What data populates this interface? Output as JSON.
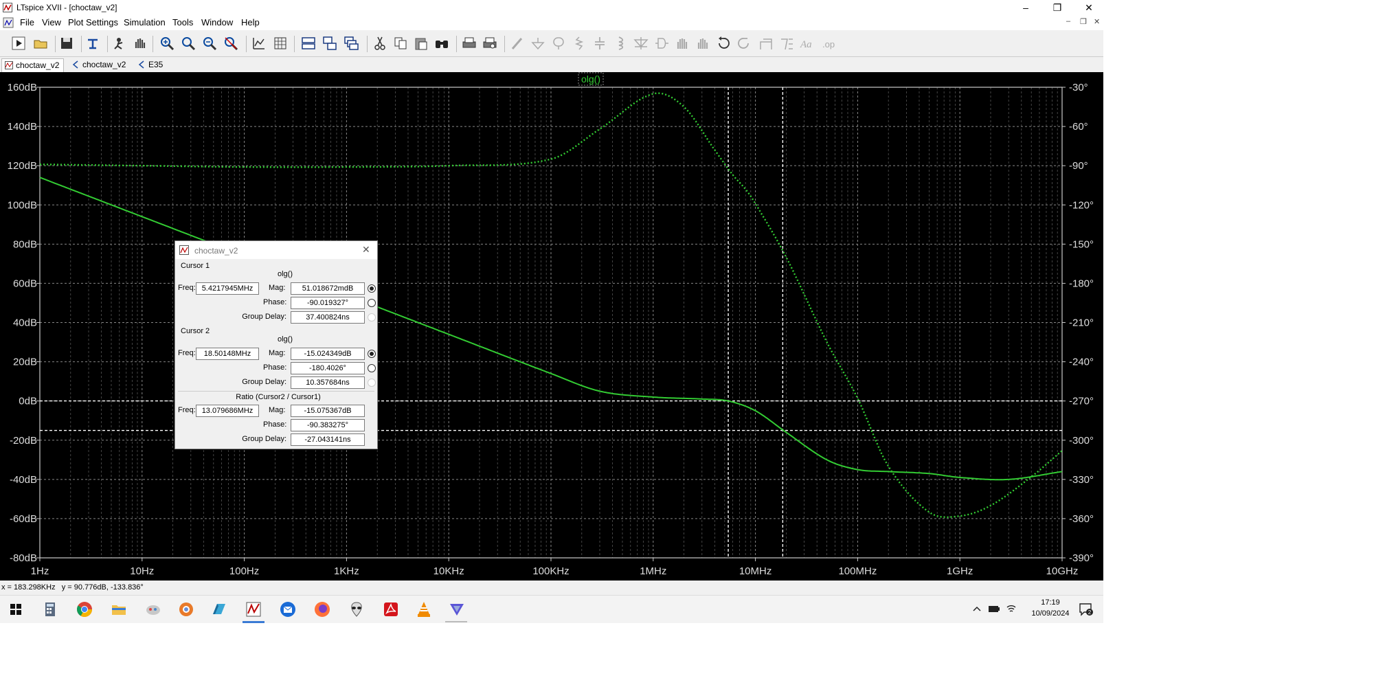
{
  "window": {
    "title": "LTspice XVII - [choctaw_v2]"
  },
  "menu": [
    "File",
    "View",
    "Plot Settings",
    "Simulation",
    "Tools",
    "Window",
    "Help"
  ],
  "tabs": [
    {
      "label": "choctaw_v2",
      "active": true
    },
    {
      "label": "choctaw_v2",
      "active": false
    },
    {
      "label": "E35",
      "active": false
    }
  ],
  "toolbar_icons": [
    "run-icon",
    "open-icon",
    "save-icon",
    "control-panel-icon",
    "halt-icon",
    "pan-icon",
    "zoom-in-icon",
    "zoom-full-icon",
    "zoom-out-icon",
    "zoom-cancel-icon",
    "autorange-icon",
    "grid-icon",
    "tile-horizontal-icon",
    "tile-vertical-icon",
    "cascade-icon",
    "cut-icon",
    "copy-icon",
    "paste-icon",
    "find-icon",
    "print-icon",
    "print-preview-icon",
    "wire-icon",
    "ground-icon",
    "label-icon",
    "resistor-icon",
    "capacitor-icon",
    "inductor-icon",
    "diode-icon",
    "component-icon",
    "move-icon",
    "drag-icon",
    "undo-icon",
    "redo-icon",
    "rotate-icon",
    "mirror-icon",
    "text-icon",
    "spice-directive-icon"
  ],
  "plot": {
    "trace_label": "olg()",
    "y_left_labels": [
      "160dB",
      "140dB",
      "120dB",
      "100dB",
      "80dB",
      "60dB",
      "40dB",
      "20dB",
      "0dB",
      "-20dB",
      "-40dB",
      "-60dB",
      "-80dB"
    ],
    "y_right_labels": [
      "-30°",
      "-60°",
      "-90°",
      "-120°",
      "-150°",
      "-180°",
      "-210°",
      "-240°",
      "-270°",
      "-300°",
      "-330°",
      "-360°",
      "-390°"
    ],
    "x_labels": [
      "1Hz",
      "10Hz",
      "100Hz",
      "1KHz",
      "10KHz",
      "100KHz",
      "1MHz",
      "10MHz",
      "100MHz",
      "1GHz",
      "10GHz"
    ],
    "colors": {
      "background": "#000000",
      "trace": "#33cc33",
      "grid": "#555555",
      "axis_text": "#dddddd"
    }
  },
  "chart_data": {
    "type": "line",
    "title": "olg()",
    "xlabel": "",
    "ylabel": "",
    "x_scale": "log",
    "xlim": [
      1,
      10000000000
    ],
    "ylim": [
      -80,
      160
    ],
    "y2lim": [
      -390,
      -30
    ],
    "series": [
      {
        "name": "olg()",
        "axis": "magnitude_dB",
        "style": "solid",
        "x": [
          1,
          10,
          100,
          1000,
          10000,
          100000,
          300000,
          1000000,
          3000000,
          5420000,
          10000000,
          20000000,
          50000000,
          100000000,
          200000000,
          500000000,
          1000000000,
          3000000000,
          10000000000
        ],
        "y": [
          114,
          94,
          74,
          54,
          34,
          14,
          5,
          2,
          1,
          0,
          -5,
          -16,
          -30,
          -35,
          -36,
          -37,
          -39,
          -40,
          -36
        ]
      },
      {
        "axis": "phase_deg",
        "style": "dotted",
        "x": [
          1,
          10,
          100,
          1000,
          10000,
          100000,
          300000,
          1000000,
          2000000,
          4000000,
          6000000,
          8000000,
          10000000,
          20000000,
          50000000,
          100000000,
          200000000,
          500000000,
          1000000000,
          2000000000,
          5000000000,
          10000000000
        ],
        "y": [
          -89,
          -90,
          -91,
          -91,
          -90,
          -85,
          -62,
          -35,
          -45,
          -78,
          -97,
          -108,
          -119,
          -160,
          -225,
          -268,
          -320,
          -355,
          -358,
          -350,
          -328,
          -308
        ]
      }
    ],
    "cursors": [
      {
        "freq_hz": 5421794.5,
        "mag_db": 0.051
      },
      {
        "freq_hz": 18501480,
        "mag_db": -15.02
      }
    ]
  },
  "dialog": {
    "title": "choctaw_v2",
    "cursor1": {
      "header": "Cursor 1",
      "trace": "olg()",
      "freq_label": "Freq:",
      "freq": "5.4217945MHz",
      "mag_label": "Mag:",
      "mag": "51.018672mdB",
      "phase_label": "Phase:",
      "phase": "-90.019327°",
      "gd_label": "Group Delay:",
      "gd": "37.400824ns"
    },
    "cursor2": {
      "header": "Cursor 2",
      "trace": "olg()",
      "freq_label": "Freq:",
      "freq": "18.50148MHz",
      "mag_label": "Mag:",
      "mag": "-15.024349dB",
      "phase_label": "Phase:",
      "phase": "-180.4026°",
      "gd_label": "Group Delay:",
      "gd": "10.357684ns"
    },
    "ratio": {
      "header": "Ratio (Cursor2 / Cursor1)",
      "freq_label": "Freq:",
      "freq": "13.079686MHz",
      "mag_label": "Mag:",
      "mag": "-15.075367dB",
      "phase_label": "Phase:",
      "phase": "-90.383275°",
      "gd_label": "Group Delay:",
      "gd": "-27.043141ns"
    }
  },
  "status": {
    "text": "x = 183.298KHz   y = 90.776dB, -133.836°"
  },
  "taskbar": {
    "icons": [
      "windows-start-icon",
      "calculator-icon",
      "chrome-icon",
      "file-explorer-icon",
      "app-icon",
      "settings-icon",
      "app-icon-2",
      "ltspice-icon",
      "thunderbird-icon",
      "firefox-icon",
      "alien-icon",
      "acrobat-icon",
      "vlc-icon",
      "app-icon-3"
    ],
    "time": "17:19",
    "date": "10/09/2024"
  }
}
